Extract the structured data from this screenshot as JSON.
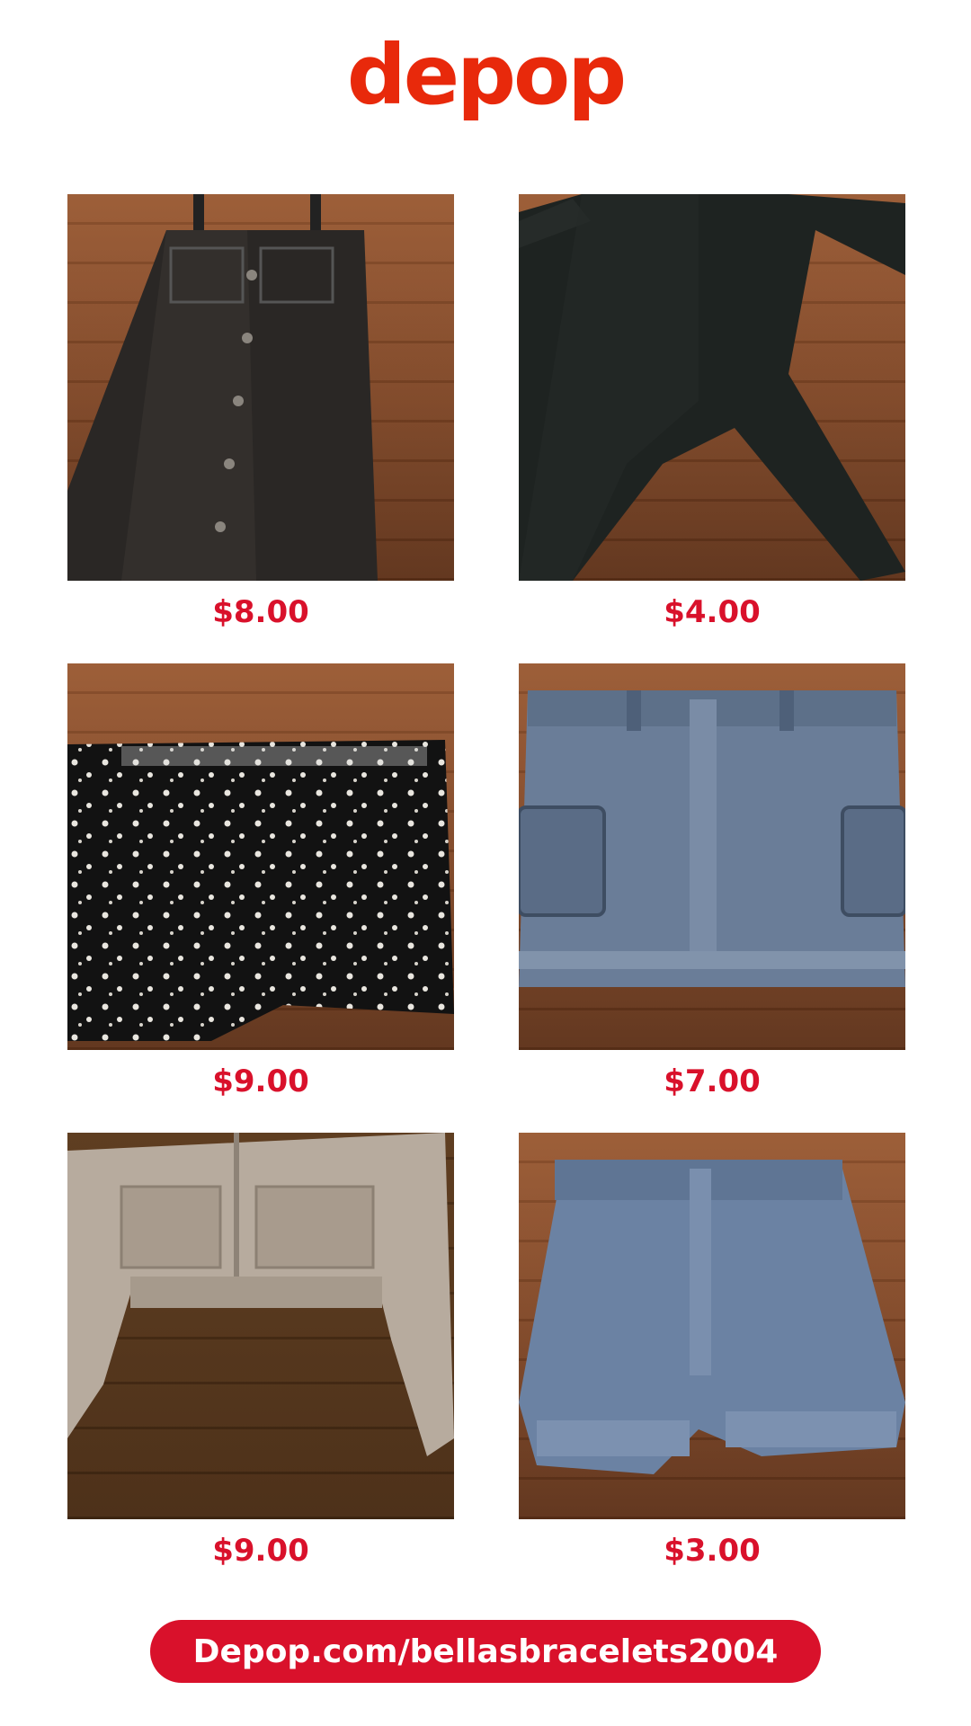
{
  "brand": {
    "logo_text": "depop",
    "logo_color": "#e8290b",
    "accent_color": "#d9112b"
  },
  "items": [
    {
      "price": "$8.00",
      "garment": "black faux-leather pinafore dress",
      "garment_color": "#2a2725"
    },
    {
      "price": "$4.00",
      "garment": "black long-sleeve jumpsuit",
      "garment_color": "#1e2321"
    },
    {
      "price": "$9.00",
      "garment": "black floral print shorts",
      "garment_color": "#121212"
    },
    {
      "price": "$7.00",
      "garment": "acid-wash denim cargo skirt",
      "garment_color": "#6a7d98"
    },
    {
      "price": "$9.00",
      "garment": "beige cropped utility jacket",
      "garment_color": "#b7ab9e"
    },
    {
      "price": "$3.00",
      "garment": "light-wash denim shorts",
      "garment_color": "#6b82a3"
    }
  ],
  "footer": {
    "link_text": "Depop.com/bellasbracelets2004"
  }
}
